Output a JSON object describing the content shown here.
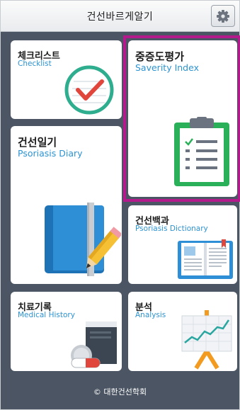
{
  "header": {
    "title": "건선바르게알기"
  },
  "tiles": {
    "checklist": {
      "ko": "체크리스트",
      "en": "Checklist"
    },
    "severity": {
      "ko": "중증도평가",
      "en": "Saverity Index"
    },
    "diary": {
      "ko": "건선일기",
      "en": "Psoriasis Diary"
    },
    "dictionary": {
      "ko": "건선백과",
      "en": "Psoriasis Dictionary"
    },
    "history": {
      "ko": "치료기록",
      "en": "Medical History"
    },
    "analysis": {
      "ko": "분석",
      "en": "Analysis"
    }
  },
  "footer": {
    "text": "© 대한건선학회"
  },
  "colors": {
    "accent": "#2c93d3",
    "highlight": "#b51a8c",
    "background": "#4b5563"
  },
  "icons": [
    "gear-icon",
    "checkmark-circle-icon",
    "clipboard-icon",
    "diary-book-icon",
    "open-book-icon",
    "medicine-record-icon",
    "chart-easel-icon"
  ]
}
